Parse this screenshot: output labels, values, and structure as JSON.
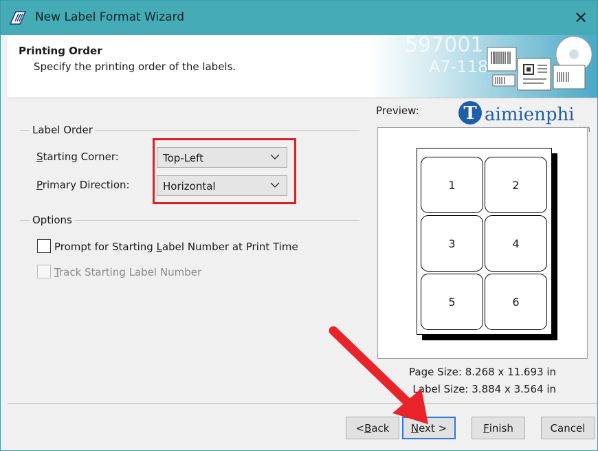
{
  "window": {
    "title": "New Label Format Wizard",
    "close_glyph": "✕"
  },
  "header": {
    "title": "Printing Order",
    "subtitle": "Specify the printing order of the labels.",
    "art_text_1": "597001",
    "art_text_2": "A7-118"
  },
  "label_order": {
    "group_title": "Label Order",
    "starting_corner": {
      "label_pre": "",
      "label_u": "S",
      "label_post": "tarting Corner:",
      "value": "Top-Left"
    },
    "primary_direction": {
      "label_pre": "",
      "label_u": "P",
      "label_post": "rimary Direction:",
      "value": "Horizontal"
    }
  },
  "options": {
    "group_title": "Options",
    "prompt": {
      "label_pre": "Prompt for Starting ",
      "label_u": "L",
      "label_post": "abel Number at Print Time",
      "checked": false
    },
    "track": {
      "label_pre": "",
      "label_u": "T",
      "label_post": "rack Starting Label Number",
      "checked": false,
      "disabled": true
    }
  },
  "preview": {
    "label": "Preview:",
    "cells": [
      "1",
      "2",
      "3",
      "4",
      "5",
      "6"
    ],
    "page_size": "Page Size:  8.268 x 11.693 in",
    "label_size": "Label Size:  3.884 x 3.564 in"
  },
  "watermark": {
    "main": "aimienphi",
    "letter": "T",
    "suffix": ".vn"
  },
  "buttons": {
    "back": {
      "pre": "< ",
      "u": "B",
      "post": "ack"
    },
    "next": {
      "pre": "",
      "u": "N",
      "post": "ext >"
    },
    "finish": {
      "pre": "",
      "u": "F",
      "post": "inish"
    },
    "cancel": "Cancel"
  },
  "colors": {
    "titlebar": "#45abb7",
    "highlight": "#dd1f26",
    "arrow": "#e8232a",
    "watermark": "#1f5ea8"
  },
  "icons": {
    "app": "barcode-app-icon",
    "close": "close-icon",
    "dropdown": "chevron-down-icon"
  }
}
